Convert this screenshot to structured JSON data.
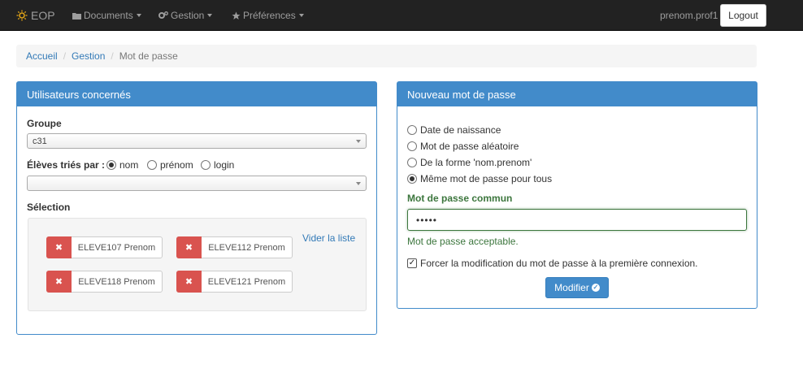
{
  "navbar": {
    "brand": "EOP",
    "menus": [
      "Documents",
      "Gestion",
      "Préférences"
    ],
    "user": "prenom.prof1",
    "logout": "Logout"
  },
  "breadcrumb": [
    "Accueil",
    "Gestion",
    "Mot de passe"
  ],
  "left_panel": {
    "title": "Utilisateurs concernés",
    "group_label": "Groupe",
    "group_value": "c31",
    "sort_label": "Élèves triés par :",
    "sort_options": [
      "nom",
      "prénom",
      "login"
    ],
    "sort_selected": "nom",
    "student_select_value": "",
    "selection_label": "Sélection",
    "clear_link": "Vider la liste",
    "selected_users": [
      "ELEVE107 Prenom",
      "ELEVE112 Prenom",
      "ELEVE118 Prenom",
      "ELEVE121 Prenom"
    ],
    "remove_glyph": "✖"
  },
  "right_panel": {
    "title": "Nouveau mot de passe",
    "options": [
      "Date de naissance",
      "Mot de passe aléatoire",
      "De la forme 'nom.prenom'",
      "Même mot de passe pour tous"
    ],
    "selected_option": "Même mot de passe pour tous",
    "common_label": "Mot de passe commun",
    "password_value": "•••••",
    "validation_message": "Mot de passe acceptable.",
    "force_change_label": "Forcer la modification du mot de passe à la première connexion.",
    "force_change_checked": true,
    "submit_label": "Modifier"
  },
  "colors": {
    "navbar": "#222222",
    "primary": "#428bca",
    "danger": "#d9534f",
    "success": "#3c763d"
  }
}
